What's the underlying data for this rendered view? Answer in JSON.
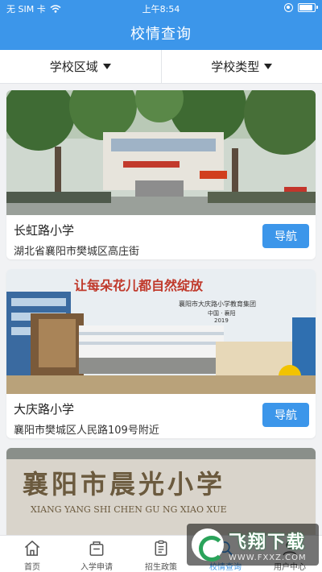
{
  "status_bar": {
    "carrier": "无 SIM 卡",
    "time": "上午8:54"
  },
  "header": {
    "title": "校情查询"
  },
  "filters": [
    {
      "label": "学校区域"
    },
    {
      "label": "学校类型"
    }
  ],
  "schools": [
    {
      "name": "长虹路小学",
      "address": "湖北省襄阳市樊城区高庄街",
      "nav_label": "导航",
      "photo_icon": "school-gate-photo"
    },
    {
      "name": "大庆路小学",
      "address": "襄阳市樊城区人民路109号附近",
      "nav_label": "导航",
      "photo_icon": "school-building-photo",
      "photo_banner": "让每朵花儿都自然绽放",
      "photo_sign": "襄阳市大庆路小学教育集团",
      "photo_sign_sub": "中国 · 襄阳",
      "photo_year": "2019"
    },
    {
      "photo_icon": "school-wall-photo",
      "photo_sign": "襄阳市晨光小学",
      "photo_sign_pinyin": "XIANG YANG SHI CHEN GU  NG XIAO XUE"
    }
  ],
  "tabs": [
    {
      "label": "首页",
      "icon": "home-icon"
    },
    {
      "label": "入学申请",
      "icon": "application-icon"
    },
    {
      "label": "招生政策",
      "icon": "policy-icon"
    },
    {
      "label": "校情查询",
      "icon": "school-query-icon",
      "active": true
    },
    {
      "label": "用户中心",
      "icon": "user-icon"
    }
  ],
  "watermark": {
    "main": "飞翔下载",
    "url": "WWW.FXXZ.COM"
  },
  "colors": {
    "primary": "#3c96ea",
    "background": "#f1f2f4"
  }
}
